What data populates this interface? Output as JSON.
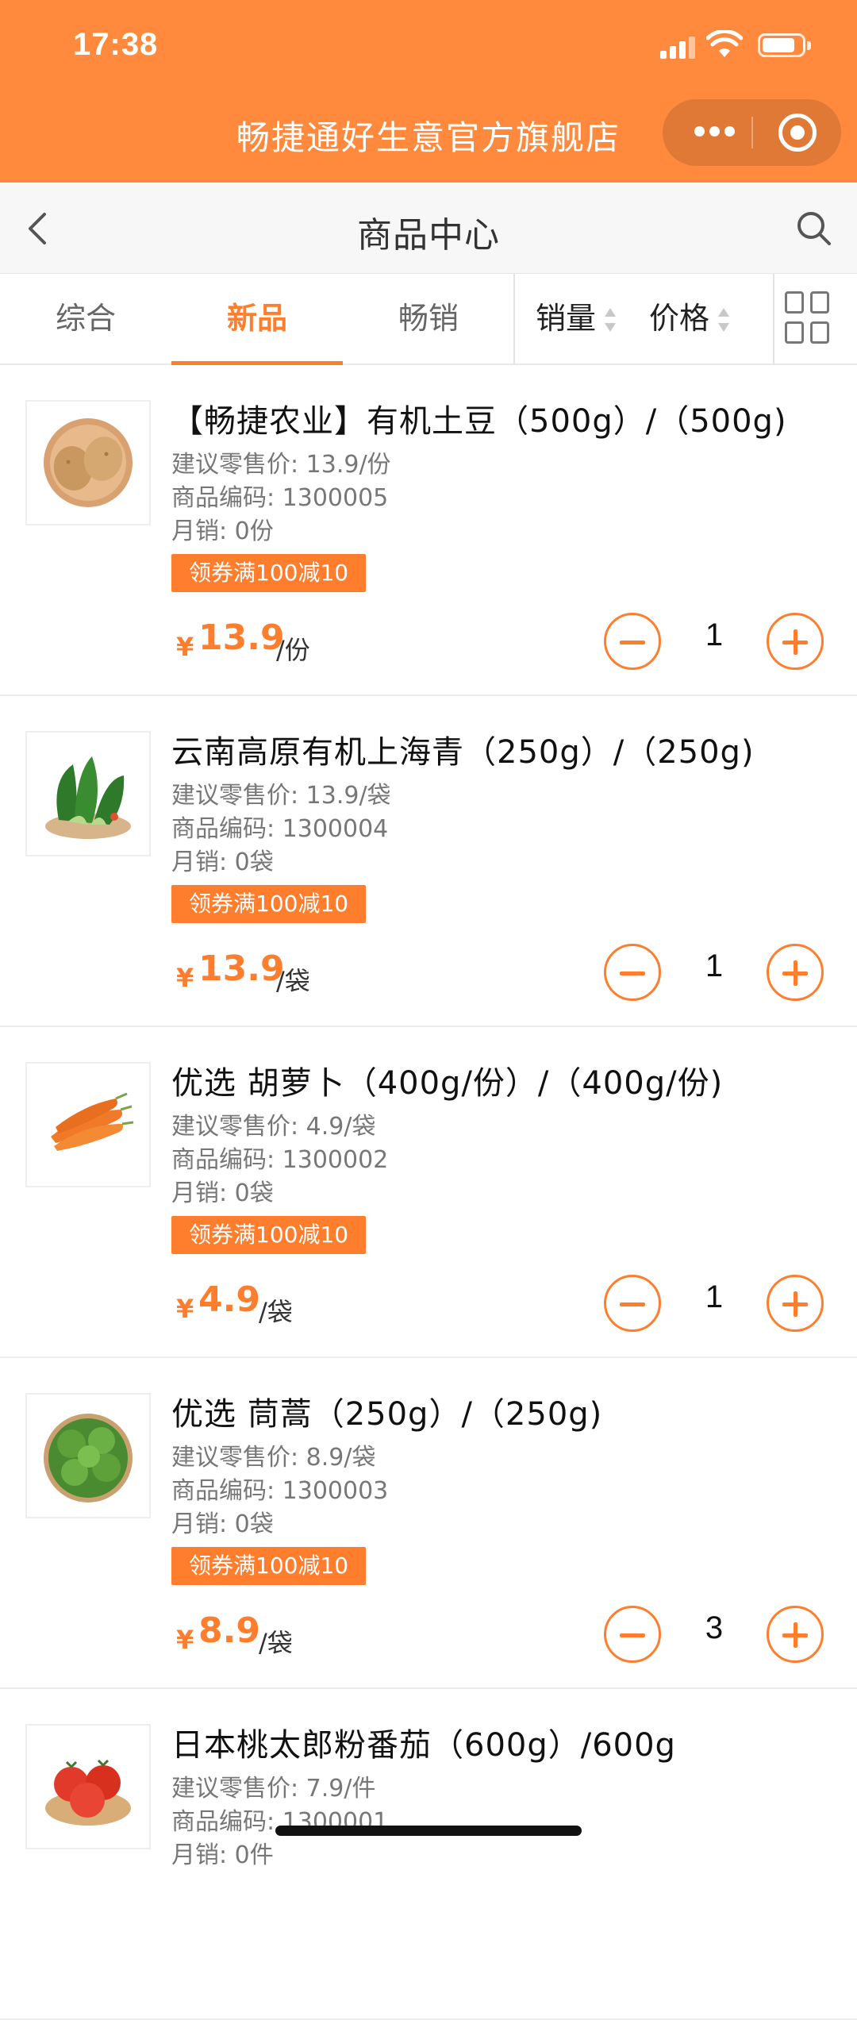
{
  "status_bar": {
    "time": "17:38"
  },
  "store": {
    "title": "畅捷通好生意官方旗舰店"
  },
  "nav": {
    "title": "商品中心"
  },
  "tabs": [
    {
      "label": "综合"
    },
    {
      "label": "新品"
    },
    {
      "label": "畅销"
    }
  ],
  "active_tab": "新品",
  "sort": {
    "sales_label": "销量",
    "price_label": "价格"
  },
  "products": [
    {
      "name": "【畅捷农业】有机土豆（500g）/（500g)",
      "retail": "建议零售价: 13.9/份",
      "code": "商品编码: 1300005",
      "monthly": "月销: 0份",
      "coupon": "领券满100减10",
      "price": "13.9",
      "unit": "/份",
      "qty": "1",
      "image": "potato"
    },
    {
      "name": "云南高原有机上海青（250g）/（250g)",
      "retail": "建议零售价: 13.9/袋",
      "code": "商品编码: 1300004",
      "monthly": "月销: 0袋",
      "coupon": "领券满100减10",
      "price": "13.9",
      "unit": "/袋",
      "qty": "1",
      "image": "bok-choy"
    },
    {
      "name": "优选 胡萝卜（400g/份）/（400g/份)",
      "retail": "建议零售价: 4.9/袋",
      "code": "商品编码: 1300002",
      "monthly": "月销: 0袋",
      "coupon": "领券满100减10",
      "price": "4.9",
      "unit": "/袋",
      "qty": "1",
      "image": "carrot"
    },
    {
      "name": "优选 茼蒿（250g）/（250g)",
      "retail": "建议零售价: 8.9/袋",
      "code": "商品编码: 1300003",
      "monthly": "月销: 0袋",
      "coupon": "领券满100减10",
      "price": "8.9",
      "unit": "/袋",
      "qty": "3",
      "image": "greens"
    },
    {
      "name": "日本桃太郎粉番茄（600g）/600g",
      "retail": "建议零售价: 7.9/件",
      "code": "商品编码: 1300001",
      "monthly": "月销: 0件",
      "image": "tomato"
    }
  ],
  "colors": {
    "brand": "#ff8a3d",
    "accent": "#ff7e2e"
  },
  "icons": {
    "back": "chevron-left-icon",
    "search": "search-icon",
    "grid": "grid-view-icon",
    "more": "more-dots-icon",
    "close": "target-circle-icon",
    "minus": "minus-circle-icon",
    "plus": "plus-circle-icon"
  }
}
